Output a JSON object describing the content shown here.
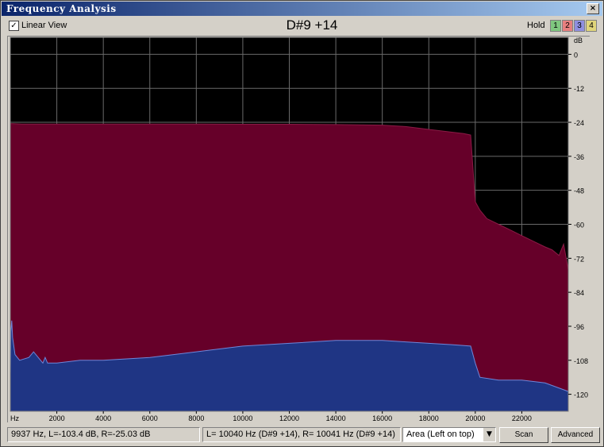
{
  "window": {
    "title": "Frequency Analysis",
    "close_glyph": "×"
  },
  "toolbar": {
    "linear_view_checked": true,
    "linear_view_label": "Linear View",
    "note": "D#9 +14",
    "hold_label": "Hold",
    "hold_buttons": [
      {
        "label": "1",
        "color": "#7fc77f"
      },
      {
        "label": "2",
        "color": "#e77f7f"
      },
      {
        "label": "3",
        "color": "#8f8fe0"
      },
      {
        "label": "4",
        "color": "#e0d57a"
      }
    ]
  },
  "chart_data": {
    "type": "area",
    "xlabel": "Hz",
    "ylabel": "dB",
    "xlim": [
      0,
      24000
    ],
    "ylim": [
      -126,
      6
    ],
    "x_ticks": [
      2000,
      4000,
      6000,
      8000,
      10000,
      12000,
      14000,
      16000,
      18000,
      20000,
      22000
    ],
    "x_tick_labels": [
      "2000",
      "4000",
      "6000",
      "8000",
      "10000",
      "12000",
      "14000",
      "16000",
      "18000",
      "20000",
      "22000"
    ],
    "y_ticks": [
      0,
      -12,
      -24,
      -36,
      -48,
      -60,
      -72,
      -84,
      -96,
      -108,
      -120
    ],
    "y_tick_labels": [
      "0",
      "-12",
      "-24",
      "-36",
      "-48",
      "-60",
      "-72",
      "-84",
      "-96",
      "-108",
      "-120"
    ],
    "grid": true,
    "background": "#000000",
    "series": [
      {
        "color": "#660029",
        "x": [
          0,
          100,
          500,
          2000,
          4000,
          6000,
          8000,
          10000,
          12000,
          14000,
          16000,
          17000,
          18000,
          19000,
          19500,
          19800,
          20000,
          20200,
          20500,
          21000,
          21500,
          22000,
          22500,
          23000,
          23300,
          23600,
          23800,
          24000
        ],
        "y": [
          -24.5,
          -24.5,
          -24.6,
          -24.6,
          -24.6,
          -24.6,
          -24.6,
          -24.7,
          -24.7,
          -24.8,
          -25.0,
          -25.5,
          -26.5,
          -27.5,
          -28.0,
          -28.5,
          -52,
          -55,
          -58,
          -60,
          -62,
          -64,
          -66,
          -68,
          -69,
          -71,
          -67,
          -76
        ]
      },
      {
        "color": "#1f3584",
        "x": [
          0,
          20,
          60,
          100,
          200,
          400,
          800,
          1000,
          1400,
          1500,
          1600,
          2000,
          3000,
          4000,
          6000,
          8000,
          10000,
          12000,
          14000,
          16000,
          17000,
          18000,
          19000,
          19800,
          20000,
          20200,
          21000,
          22000,
          23000,
          24000
        ],
        "y": [
          -113,
          -98,
          -94,
          -100,
          -106,
          -108,
          -107,
          -105,
          -109,
          -107,
          -109,
          -109,
          -108,
          -108,
          -107,
          -105,
          -103,
          -102,
          -101,
          -101,
          -101.5,
          -102,
          -102.5,
          -103,
          -109,
          -114,
          -115,
          -115,
          -116,
          -119
        ]
      }
    ]
  },
  "status": {
    "cursor": "9937 Hz, L=-103.4 dB, R=-25.03 dB",
    "peak": "L=  10040 Hz (D#9 +14), R=  10041 Hz (D#9 +14)",
    "view_mode": "Area (Left on top)",
    "scan_label": "Scan",
    "advanced_label": "Advanced"
  }
}
